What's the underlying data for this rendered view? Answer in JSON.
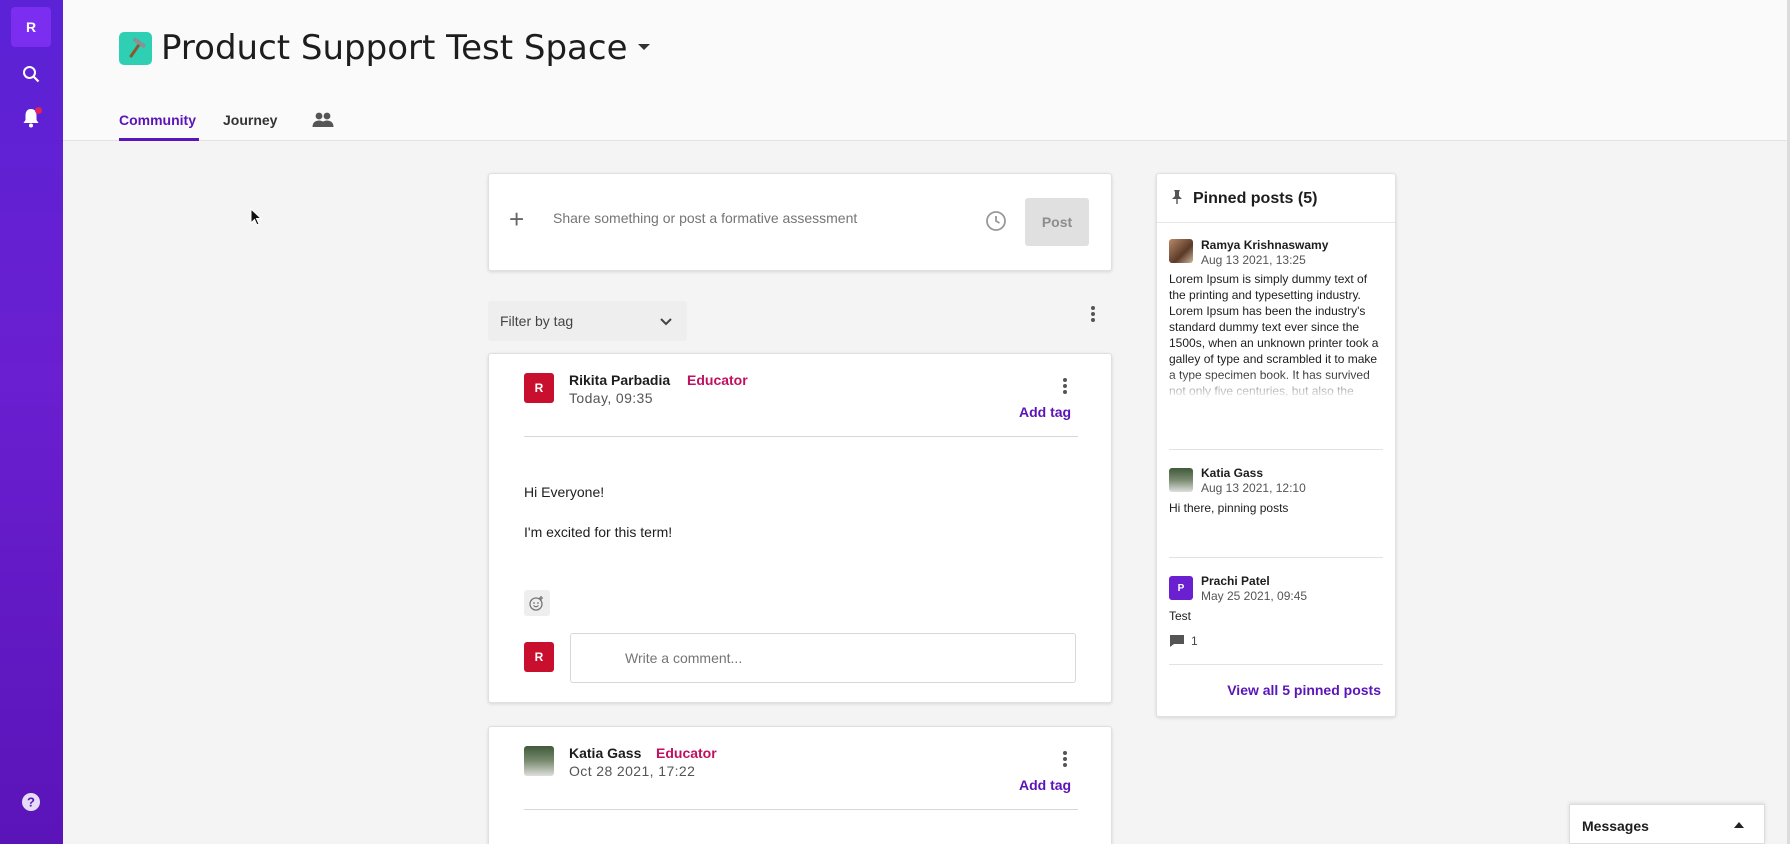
{
  "rail": {
    "avatar_letter": "R",
    "icons": [
      "search-icon",
      "bell-icon",
      "help-icon"
    ],
    "accent": "#5b22d6"
  },
  "header": {
    "title": "Product Support Test Space",
    "emoji": "hammer-pick-icon",
    "tabs": [
      {
        "label": "Community",
        "active": true
      },
      {
        "label": "Journey",
        "active": false
      }
    ],
    "members_icon": "people-icon"
  },
  "composer": {
    "placeholder": "Share something or post a formative assessment",
    "post_label": "Post"
  },
  "filter": {
    "label": "Filter by tag"
  },
  "posts": [
    {
      "avatar_letter": "R",
      "author": "Rikita Parbadia",
      "role": "Educator",
      "time": "Today, 09:35",
      "add_tag": "Add tag",
      "body": [
        "Hi Everyone!",
        "I'm excited for this term!"
      ],
      "comment_avatar_letter": "R",
      "comment_placeholder": "Write a comment..."
    },
    {
      "author": "Katia Gass",
      "role": "Educator",
      "time": "Oct 28 2021, 17:22",
      "add_tag": "Add tag"
    }
  ],
  "pinned": {
    "title": "Pinned posts (5)",
    "items": [
      {
        "author": "Ramya Krishnaswamy",
        "date": "Aug 13 2021, 13:25",
        "text": "Lorem Ipsum is simply dummy text of the printing and typesetting industry. Lorem Ipsum has been the industry's standard dummy text ever since the 1500s, when an unknown printer took a galley of type and scrambled it to make a type specimen book. It has survived not only five centuries, but also the"
      },
      {
        "author": "Katia Gass",
        "date": "Aug 13 2021, 12:10",
        "text": "Hi there, pinning posts"
      },
      {
        "avatar_letter": "P",
        "author": "Prachi Patel",
        "date": "May 25 2021, 09:45",
        "text": "Test",
        "comment_count": "1"
      }
    ],
    "view_all": "View all 5 pinned posts"
  },
  "messages": {
    "label": "Messages"
  },
  "colors": {
    "brand_purple": "#5a14b8",
    "educator_role": "#c01060",
    "avatar_red": "#c8102e"
  }
}
